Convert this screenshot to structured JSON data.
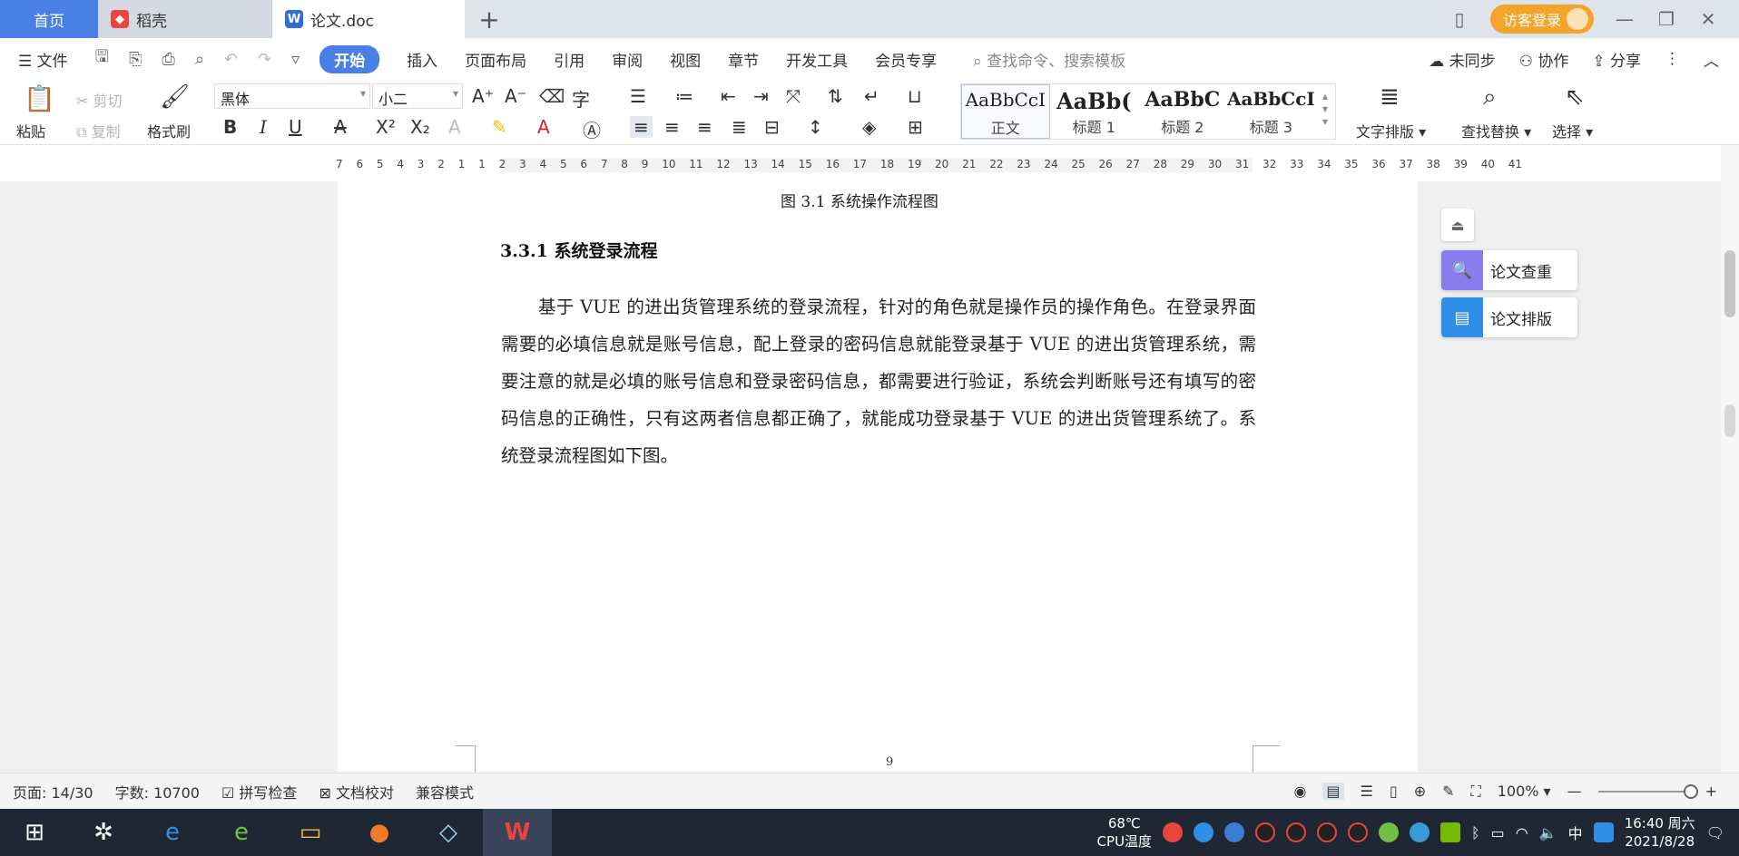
{
  "tabs": {
    "home": "首页",
    "daoke": "稻壳",
    "doc": "论文.doc",
    "new": "+",
    "visitor_login": "访客登录"
  },
  "menu": {
    "file": "文件",
    "start": "开始",
    "items": [
      "插入",
      "页面布局",
      "引用",
      "审阅",
      "视图",
      "章节",
      "开发工具",
      "会员专享"
    ],
    "search_placeholder": "查找命令、搜索模板",
    "unsynced": "未同步",
    "collab": "协作",
    "share": "分享"
  },
  "ribbon": {
    "paste": "粘贴",
    "cut": "剪切",
    "copy": "复制",
    "format_painter": "格式刷",
    "font_name": "黑体",
    "font_size": "小二",
    "styles": [
      {
        "preview": "AaBbCcI",
        "name": "正文"
      },
      {
        "preview": "AaBb(",
        "name": "标题 1"
      },
      {
        "preview": "AaBbC",
        "name": "标题 2"
      },
      {
        "preview": "AaBbCcI",
        "name": "标题 3"
      }
    ],
    "text_layout": "文字排版",
    "find_replace": "查找替换",
    "select": "选择"
  },
  "ruler": {
    "scale": "7 6 5 4 3 2 1 1 2 3 4 5 6 7 8 9 10 11 12 13 14 15 16 17 18 19 20 21 22 23 24 25 26 27 28 29 30 31 32 33 34 35 36 37 38 39 40 41"
  },
  "document": {
    "caption": "图 3.1  系统操作流程图",
    "heading": "3.3.1 系统登录流程",
    "paragraph": "基于 VUE 的进出货管理系统的登录流程，针对的角色就是操作员的操作角色。在登录界面需要的必填信息就是账号信息，配上登录的密码信息就能登录基于 VUE 的进出货管理系统，需要注意的就是必填的账号信息和登录密码信息，都需要进行验证，系统会判断账号还有填写的密码信息的正确性，只有这两者信息都正确了，就能成功登录基于 VUE 的进出货管理系统了。系统登录流程图如下图。",
    "page_number": "9"
  },
  "side_panel": {
    "plagiarism_check": "论文查重",
    "thesis_layout": "论文排版"
  },
  "status": {
    "page": "页面: 14/30",
    "word_count": "字数: 10700",
    "spell_check": "拼写检查",
    "doc_proofread": "文档校对",
    "compat_mode": "兼容模式",
    "zoom": "100%"
  },
  "taskbar": {
    "temp": "68℃",
    "cpu_label": "CPU温度",
    "ime": "中",
    "time": "16:40 周六",
    "date": "2021/8/28"
  },
  "colors": {
    "accent": "#4a80e6",
    "visitor": "#f5a42a",
    "taskbar": "#1f2735"
  }
}
